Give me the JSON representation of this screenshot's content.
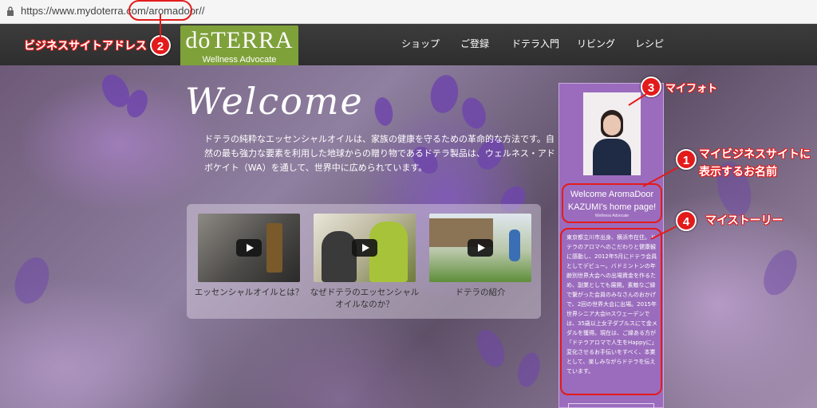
{
  "browser": {
    "url_prefix": "https://www.mydoterra.com/",
    "url_path": "aromadoor/",
    "url_suffix": "/"
  },
  "header": {
    "logo_main": "dōTERRA",
    "logo_sub": "Wellness Advocate",
    "nav": [
      "ショップ",
      "ご登録",
      "ドテラ入門",
      "リビング",
      "レシピ"
    ]
  },
  "annotations": [
    {
      "number": "1",
      "label_line1": "マイビジネスサイトに",
      "label_line2": "表示するお名前"
    },
    {
      "number": "2",
      "label": "ビジネスサイトアドレス"
    },
    {
      "number": "3",
      "label": "マイフォト"
    },
    {
      "number": "4",
      "label": "マイストーリー"
    }
  ],
  "hero": {
    "title": "Welcome",
    "intro": "ドテラの純粋なエッセンシャルオイルは、家族の健康を守るための革命的な方法です。自然の最も強力な要素を利用した地球からの贈り物であるドテラ製品は、ウェルネス・アドボケイト（WA）を通して、世界中に広められています。",
    "videos": [
      {
        "caption": "エッセンシャルオイルとは？"
      },
      {
        "caption": "なぜドテラのエッセンシャルオイルなのか？"
      },
      {
        "caption": "ドテラの紹介"
      }
    ]
  },
  "sidebar": {
    "welcome_line1": "Welcome AromaDoor",
    "welcome_line2": "KAZUMI's home page!",
    "welcome_sub": "Wellness Advocate",
    "story": "東京都立川市出身、横浜市在住。ドテラのアロマへのこだわりと健康観に感動し、2012年5月にドテラ会員としてデビュー。バドミントンの年齢別世界大会への出場資金を作るため、副業としても展開。素敵なご縁で繋がった会員のみなさんのおかげで、2回の世界大会に出場。2015年世界シニア大会inスウェーデンでは、35歳以上女子ダブルスにて金メダルを獲得。現在は、ご縁ある方が「ドテラアロマで人生をHappyに」変化させるお手伝いをすべく、本業として、楽しみながらドテラを伝えています。"
  },
  "colors": {
    "annotation_red": "#e31b1b",
    "logo_green": "#7fa13a",
    "sidebar_purple": "#9b6cbd",
    "header_dark": "#333333"
  }
}
